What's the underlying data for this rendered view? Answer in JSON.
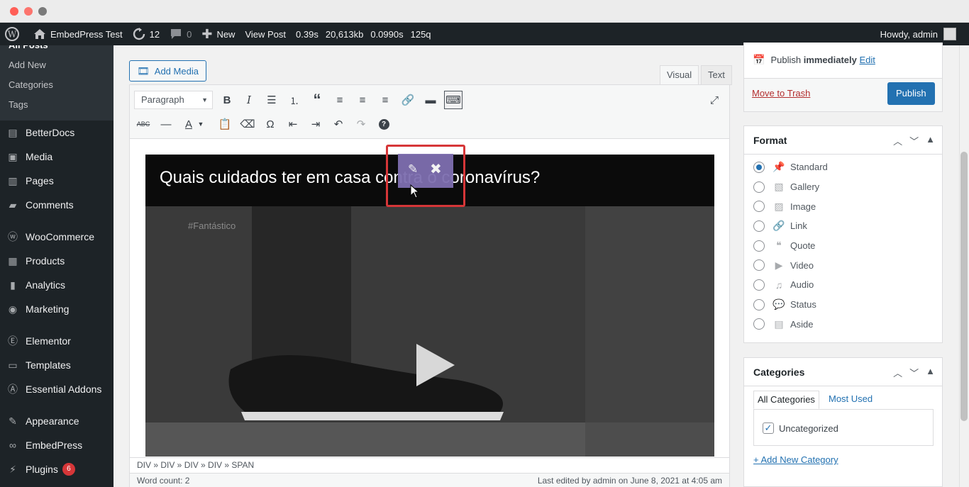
{
  "adminbar": {
    "site_name": "EmbedPress Test",
    "updates_count": "12",
    "comments_count": "0",
    "new_label": "New",
    "view_post": "View Post",
    "stat_time": "0.39s",
    "stat_memory": "20,613kb",
    "stat_db_time": "0.0990s",
    "stat_queries": "125q",
    "howdy": "Howdy, admin"
  },
  "sidebar": {
    "posts_submenu": [
      "All Posts",
      "Add New",
      "Categories",
      "Tags"
    ],
    "items": [
      {
        "label": "BetterDocs",
        "icon": "docs-icon"
      },
      {
        "label": "Media",
        "icon": "media-icon"
      },
      {
        "label": "Pages",
        "icon": "pages-icon"
      },
      {
        "label": "Comments",
        "icon": "comments-icon"
      },
      {
        "label": "WooCommerce",
        "icon": "woo-icon"
      },
      {
        "label": "Products",
        "icon": "products-icon"
      },
      {
        "label": "Analytics",
        "icon": "analytics-icon"
      },
      {
        "label": "Marketing",
        "icon": "marketing-icon"
      },
      {
        "label": "Elementor",
        "icon": "elementor-icon"
      },
      {
        "label": "Templates",
        "icon": "templates-icon"
      },
      {
        "label": "Essential Addons",
        "icon": "ea-icon"
      },
      {
        "label": "Appearance",
        "icon": "appearance-icon"
      },
      {
        "label": "EmbedPress",
        "icon": "embedpress-icon"
      },
      {
        "label": "Plugins",
        "icon": "plugins-icon",
        "badge": "6"
      }
    ]
  },
  "editor": {
    "add_media": "Add Media",
    "tab_visual": "Visual",
    "tab_text": "Text",
    "format_select": "Paragraph",
    "video_title": "Quais cuidados ter em casa contra o coronavírus?",
    "video_watermark": "#Fantástico",
    "path": "DIV » DIV » DIV » DIV » SPAN",
    "word_count": "Word count: 2",
    "last_edited": "Last edited by admin on June 8, 2021 at 4:05 am"
  },
  "publish_box": {
    "publish_immediately_prefix": "Publish",
    "publish_immediately_strong": "immediately",
    "edit_link": "Edit",
    "trash": "Move to Trash",
    "publish_button": "Publish"
  },
  "format_box": {
    "title": "Format",
    "options": [
      "Standard",
      "Gallery",
      "Image",
      "Link",
      "Quote",
      "Video",
      "Audio",
      "Status",
      "Aside"
    ],
    "selected": "Standard"
  },
  "categories_box": {
    "title": "Categories",
    "tab_all": "All Categories",
    "tab_used": "Most Used",
    "items": [
      {
        "label": "Uncategorized",
        "checked": true
      }
    ],
    "add_new": "+ Add New Category"
  },
  "colors": {
    "accent": "#2271b1",
    "admin_bar": "#1d2327",
    "highlight_box": "#d63638",
    "embed_toolbar": "#7e6fb0"
  }
}
